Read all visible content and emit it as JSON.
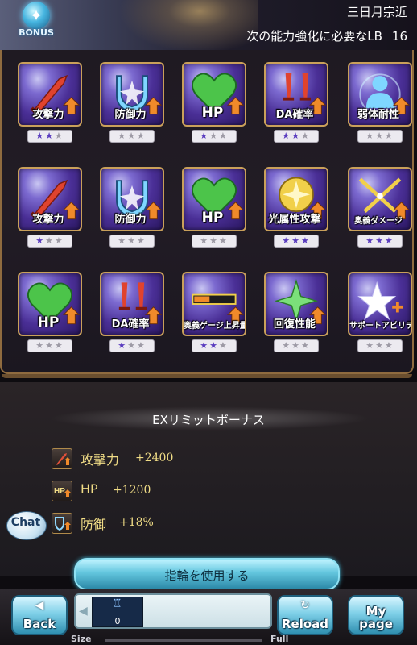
{
  "header": {
    "bonus_label": "BONUS",
    "character_name": "三日月宗近",
    "lb_prompt": "次の能力強化に必要なLB",
    "lb_required": "16"
  },
  "skills": [
    [
      {
        "label": "攻撃力",
        "icon": "sword-icon",
        "stars": 2
      },
      {
        "label": "防御力",
        "icon": "shield-icon",
        "stars": 0
      },
      {
        "label": "HP",
        "icon": "heart-icon",
        "stars": 1
      },
      {
        "label": "DA確率",
        "icon": "double-sword-icon",
        "stars": 2
      },
      {
        "label": "弱体耐性",
        "icon": "resist-icon",
        "stars": 0
      }
    ],
    [
      {
        "label": "攻撃力",
        "icon": "sword-icon",
        "stars": 1
      },
      {
        "label": "防御力",
        "icon": "shield-icon",
        "stars": 0
      },
      {
        "label": "HP",
        "icon": "heart-icon",
        "stars": 0
      },
      {
        "label": "光属性攻撃",
        "icon": "light-orb-icon",
        "stars": 3
      },
      {
        "label": "奥義ダメージ",
        "icon": "crossed-swords-icon",
        "stars": 3
      }
    ],
    [
      {
        "label": "HP",
        "icon": "heart-icon",
        "stars": 0
      },
      {
        "label": "DA確率",
        "icon": "double-sword-icon",
        "stars": 1
      },
      {
        "label": "奥義ゲージ上昇量",
        "icon": "gauge-icon",
        "stars": 2
      },
      {
        "label": "回復性能",
        "icon": "sparkle-icon",
        "stars": 0
      },
      {
        "label": "サポートアビリティ",
        "icon": "star-plus-icon",
        "stars": 0
      }
    ]
  ],
  "ex_bonus": {
    "title": "EXリミットボーナス",
    "items": [
      {
        "name": "攻撃力",
        "value": "+2400",
        "icon": "attack-up-icon"
      },
      {
        "name": "HP",
        "value": "+1200",
        "icon": "hp-up-icon"
      },
      {
        "name": "防御",
        "value": "+18%",
        "icon": "defense-up-icon"
      }
    ]
  },
  "chat_label": "Chat",
  "use_ring_label": "指輪を使用する",
  "nav": {
    "back_label": "Back",
    "reload_label": "Reload",
    "mypage_line1": "My",
    "mypage_line2": "page",
    "slot_count": "0",
    "size_label": "Size",
    "full_label": "Full"
  },
  "colors": {
    "gold_text": "#f0dc86",
    "frame_gold": "#c9a05a",
    "star_on": "#5a3cbf"
  }
}
